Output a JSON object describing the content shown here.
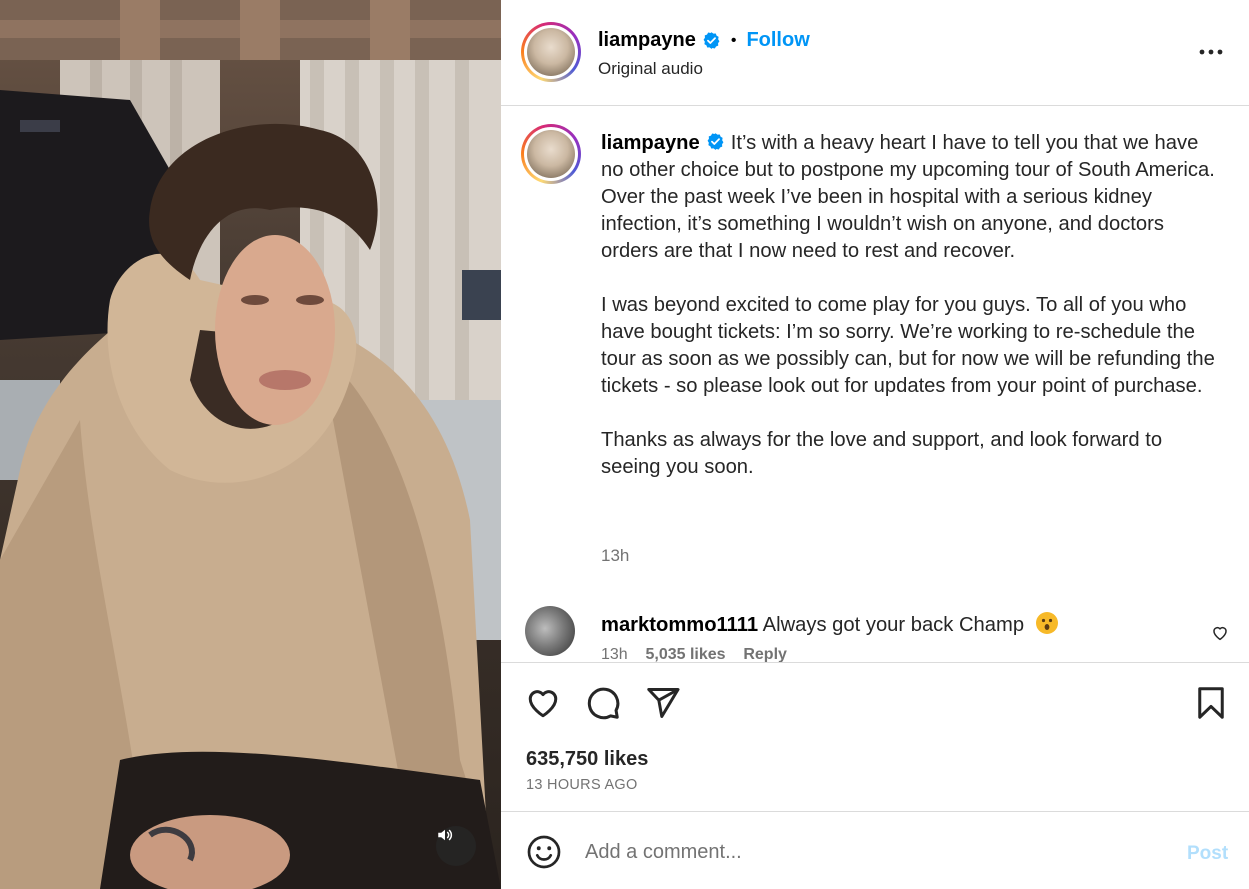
{
  "post": {
    "username": "liampayne",
    "follow_label": "Follow",
    "separator": "•",
    "audio": "Original audio"
  },
  "caption": {
    "username": "liampayne",
    "paragraphs": [
      "It’s with a heavy heart I have to tell you that we have no other choice but to postpone my upcoming tour of South America. Over the past week I’ve been in hospital with a serious kidney infection, it’s something I wouldn’t wish on anyone, and doctors orders are that I now need to rest and recover.",
      "I was beyond excited to come play for you guys. To all of you who have bought tickets: I’m so sorry. We’re working to re-schedule the tour as soon as we possibly can, but for now we will be refunding the tickets - so please look out for updates from your point of purchase.",
      "Thanks as always for the love and support, and look forward to seeing you soon."
    ],
    "time": "13h"
  },
  "comment": {
    "username": "marktommo1111",
    "text": "Always got your back Champ",
    "emoji": "hushed-face-emoji",
    "time": "13h",
    "likes": "5,035 likes",
    "reply": "Reply"
  },
  "actions": {
    "likes": "635,750 likes",
    "time_ago": "13 HOURS AGO"
  },
  "add_comment": {
    "placeholder": "Add a comment...",
    "post_label": "Post"
  },
  "colors": {
    "accent": "#0095f6",
    "post_disabled": "#b2dffc",
    "verified": "#0095f6",
    "muted_text": "#737373",
    "divider": "#dbdbdb"
  },
  "icons": [
    "verified-badge-icon",
    "more-options-icon",
    "heart-icon",
    "comment-icon",
    "share-icon",
    "save-icon",
    "emoji-icon",
    "volume-icon"
  ]
}
